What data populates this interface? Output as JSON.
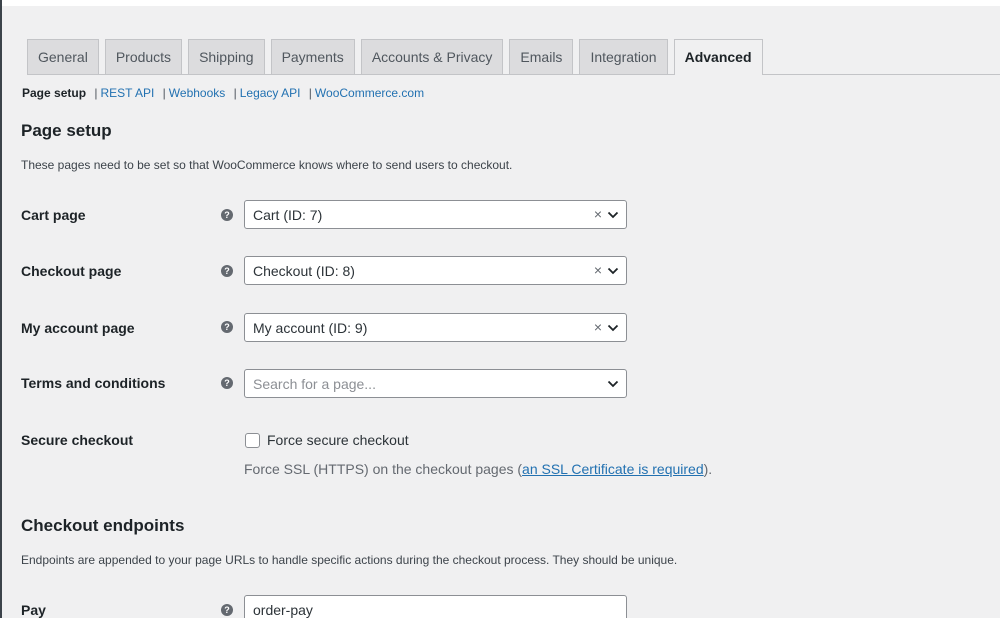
{
  "tabs": [
    {
      "label": "General"
    },
    {
      "label": "Products"
    },
    {
      "label": "Shipping"
    },
    {
      "label": "Payments"
    },
    {
      "label": "Accounts & Privacy"
    },
    {
      "label": "Emails"
    },
    {
      "label": "Integration"
    },
    {
      "label": "Advanced",
      "active": true
    }
  ],
  "subnav": {
    "current": "Page setup",
    "links": [
      "REST API",
      "Webhooks",
      "Legacy API",
      "WooCommerce.com"
    ],
    "separator": "|"
  },
  "page_setup": {
    "title": "Page setup",
    "description": "These pages need to be set so that WooCommerce knows where to send users to checkout.",
    "fields": {
      "cart": {
        "label": "Cart page",
        "value": "Cart (ID: 7)"
      },
      "checkout": {
        "label": "Checkout page",
        "value": "Checkout (ID: 8)"
      },
      "myaccount": {
        "label": "My account page",
        "value": "My account (ID: 9)"
      },
      "terms": {
        "label": "Terms and conditions",
        "placeholder": "Search for a page..."
      }
    },
    "secure_checkout": {
      "label": "Secure checkout",
      "checkbox_label": "Force secure checkout",
      "checked": false,
      "desc_prefix": "Force SSL (HTTPS) on the checkout pages (",
      "link_text": "an SSL Certificate is required",
      "desc_suffix": ")."
    }
  },
  "checkout_endpoints": {
    "title": "Checkout endpoints",
    "description": "Endpoints are appended to your page URLs to handle specific actions during the checkout process. They should be unique.",
    "pay": {
      "label": "Pay",
      "value": "order-pay"
    }
  },
  "glyphs": {
    "help": "?",
    "clear": "×"
  },
  "colors": {
    "link": "#2271b1",
    "background": "#f0f0f1",
    "text": "#1d2327"
  }
}
